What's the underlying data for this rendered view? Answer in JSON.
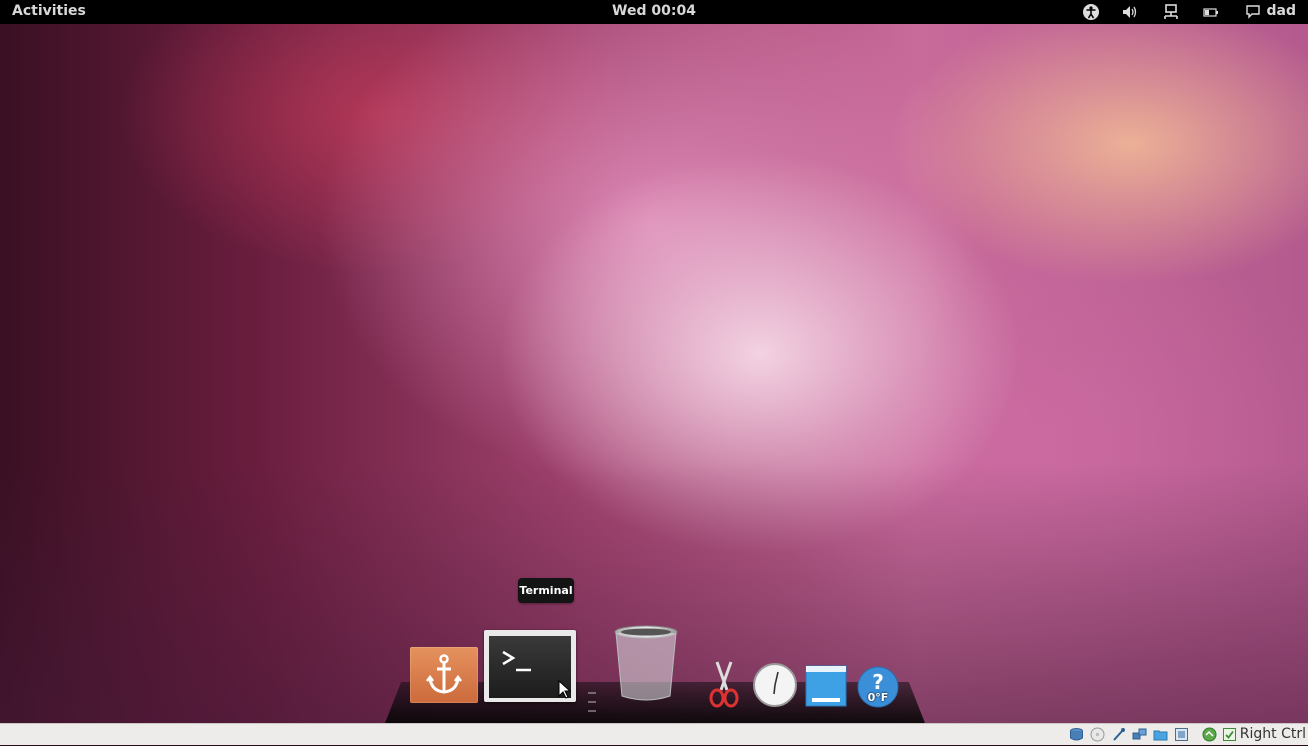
{
  "top_panel": {
    "activities_label": "Activities",
    "clock": "Wed 00:04",
    "user_name": "dad",
    "tray": [
      "accessibility-icon",
      "volume-icon",
      "network-icon",
      "battery-icon",
      "chat-status-icon"
    ]
  },
  "tooltip": {
    "text": "Terminal"
  },
  "dock": {
    "items": [
      "anchor-app-icon",
      "terminal-icon",
      "trash-icon",
      "scissors-icon",
      "clock-icon",
      "window-icon",
      "weather-help-icon"
    ],
    "weather_temp": "0°F"
  },
  "statusbar": {
    "host_key_label": "Right Ctrl",
    "icons": [
      "hard-disk-icon",
      "optical-drive-icon",
      "usb-icon",
      "network-adapters-icon",
      "shared-folders-icon",
      "video-capture-icon",
      "mouse-integration-icon",
      "host-key-indicator-icon"
    ]
  },
  "colors": {
    "panel_bg": "#000000",
    "wallpaper_accent": "#c86a9a",
    "statusbar_bg": "#edeceb"
  }
}
